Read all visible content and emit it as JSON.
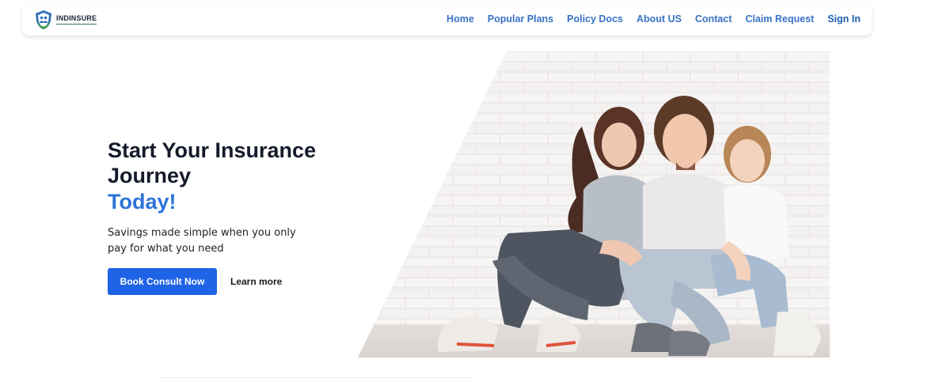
{
  "brand": {
    "name": "INDINSURE"
  },
  "nav": {
    "items": [
      "Home",
      "Popular Plans",
      "Policy Docs",
      "About US",
      "Contact",
      "Claim Request"
    ],
    "sign_in": "Sign In"
  },
  "hero": {
    "title_line1": "Start Your Insurance Journey",
    "title_line2": "Today!",
    "subtitle": "Savings made simple when you only pay for what you need",
    "primary_cta": "Book Consult Now",
    "secondary_cta": "Learn more"
  },
  "colors": {
    "accent": "#1f63e6",
    "nav_link": "#3873c4",
    "heading": "#151b2b",
    "brand_green": "#2f7d4b"
  }
}
